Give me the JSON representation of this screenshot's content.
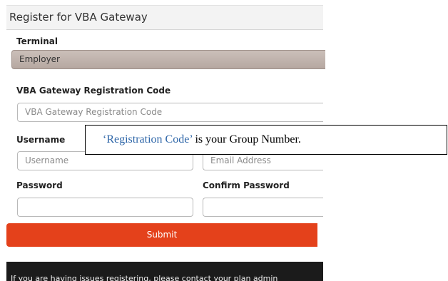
{
  "header": {
    "title": "Register for VBA Gateway"
  },
  "terminal": {
    "label": "Terminal",
    "value": "Employer"
  },
  "registration_code": {
    "label": "VBA Gateway Registration Code",
    "placeholder": "VBA Gateway Registration Code"
  },
  "username": {
    "label": "Username",
    "placeholder": "Username"
  },
  "email": {
    "placeholder": "Email Address"
  },
  "password": {
    "label": "Password",
    "value": ""
  },
  "confirm_password": {
    "label": "Confirm Password",
    "value": ""
  },
  "submit": {
    "label": "Submit"
  },
  "footer": {
    "text": "If you are having issues registering, please contact your plan admin"
  },
  "callout": {
    "accent": "‘Registration Code’",
    "rest": " is your Group Number."
  },
  "colors": {
    "submit": "#e4411b",
    "callout_accent": "#2e66a8",
    "footer_bg": "#1b1b1b",
    "terminal_bg": "#b6a8a1"
  }
}
